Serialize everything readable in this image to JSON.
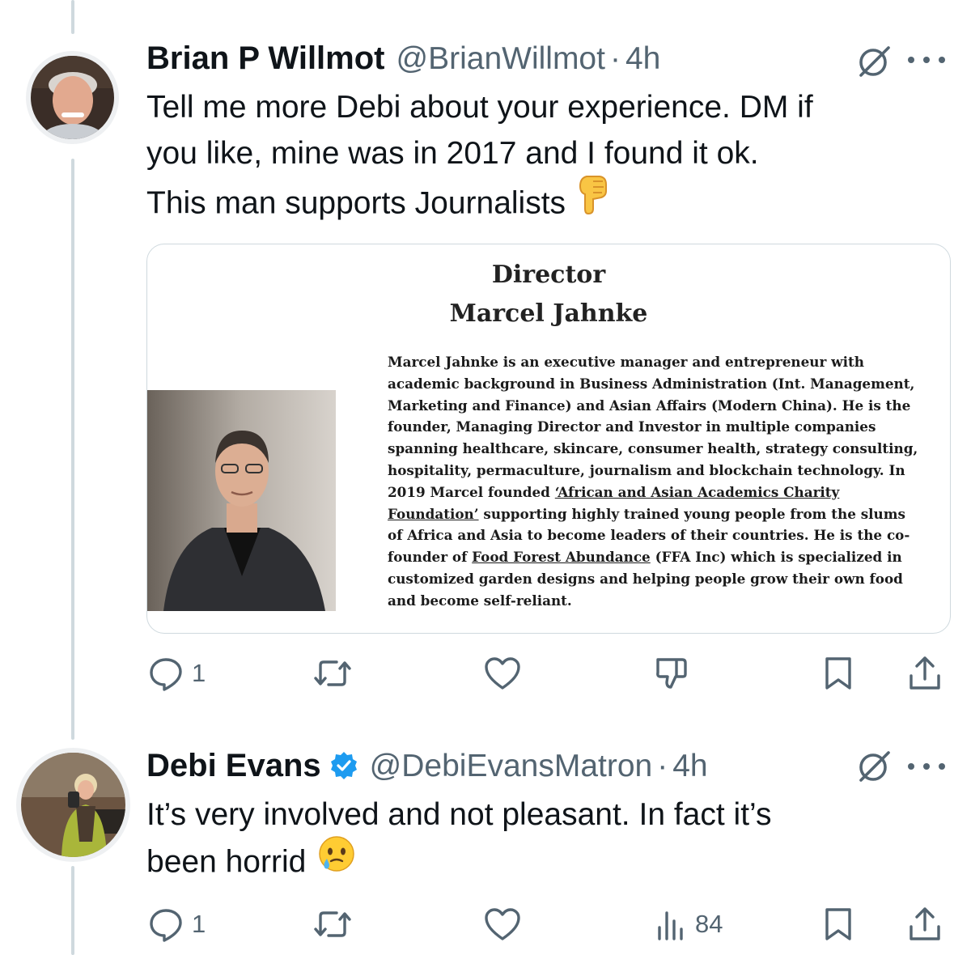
{
  "tweets": [
    {
      "author_name": "Brian P Willmot",
      "handle": "@BrianWillmot",
      "separator": "·",
      "time": "4h",
      "verified": false,
      "text_lines": [
        "Tell me more Debi about your experience. DM if",
        "you like, mine was in 2017 and I found it ok.",
        "This man supports Journalists"
      ],
      "emoji": "backhand-index-pointing-down",
      "media": {
        "title_line1": "Director",
        "title_line2": "Marcel Jahnke",
        "bio_parts": [
          "Marcel Jahnke is an executive manager and entrepreneur with academic background in Business Administration (Int. Management, Marketing and Finance) and Asian Affairs (Modern China). He is the founder, Managing Director and Investor in multiple companies spanning healthcare, skincare, consumer health, strategy consulting, hospitality, permaculture, journalism and blockchain technology. In 2019 Marcel founded ",
          "‘African and Asian Academics Charity Foundation’",
          " supporting highly trained young people from the slums of Africa and Asia to become leaders of their countries. He is the co-founder of ",
          "Food Forest Abundance",
          " (FFA Inc) which is specialized in customized garden designs and helping people grow their own food and become self-reliant."
        ]
      },
      "actions": {
        "reply_count": "1",
        "retweet_count": "",
        "like_count": "",
        "fourth_icon": "dislike-icon",
        "fourth_count": ""
      }
    },
    {
      "author_name": "Debi Evans",
      "handle": "@DebiEvansMatron",
      "separator": "·",
      "time": "4h",
      "verified": true,
      "text_lines": [
        "It’s very involved and not pleasant. In fact it’s",
        "been horrid"
      ],
      "emoji": "face-holding-back-tears",
      "actions": {
        "reply_count": "1",
        "retweet_count": "",
        "like_count": "",
        "fourth_icon": "views-icon",
        "fourth_count": "84"
      }
    }
  ],
  "colors": {
    "text_primary": "#0f1419",
    "text_secondary": "#536471",
    "thread_line": "#cfd9de",
    "verified_blue": "#1d9bf0"
  }
}
